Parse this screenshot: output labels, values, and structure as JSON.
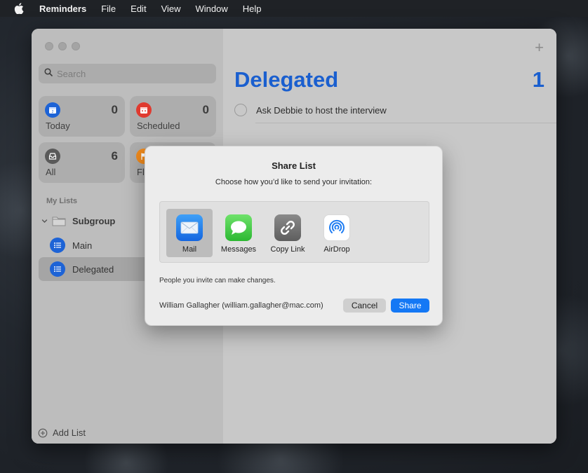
{
  "menubar": {
    "app": "Reminders",
    "items": [
      "File",
      "Edit",
      "View",
      "Window",
      "Help"
    ]
  },
  "sidebar": {
    "search_placeholder": "Search",
    "smart_lists": [
      {
        "label": "Today",
        "count": "0",
        "color": "#1d63d6",
        "icon": "calendar-icon"
      },
      {
        "label": "Scheduled",
        "count": "0",
        "color": "#e03a2f",
        "icon": "scheduled-calendar-icon"
      },
      {
        "label": "All",
        "count": "6",
        "color": "#5a5a5a",
        "icon": "tray-icon"
      },
      {
        "label": "Fl",
        "count": "",
        "color": "#f08a1c",
        "icon": "flag-icon"
      }
    ],
    "my_lists_heading": "My Lists",
    "group": {
      "label": "Subgroup"
    },
    "lists": [
      {
        "label": "Main"
      },
      {
        "label": "Delegated"
      }
    ],
    "add_list": "Add List"
  },
  "main": {
    "title": "Delegated",
    "count": "1",
    "tasks": [
      {
        "text": "Ask Debbie to host the interview"
      }
    ]
  },
  "dialog": {
    "title": "Share List",
    "subtitle": "Choose how you’d like to send your invitation:",
    "options": [
      {
        "label": "Mail",
        "icon": "mail-icon"
      },
      {
        "label": "Messages",
        "icon": "messages-icon"
      },
      {
        "label": "Copy Link",
        "icon": "link-icon"
      },
      {
        "label": "AirDrop",
        "icon": "airdrop-icon"
      }
    ],
    "note": "People you invite can make changes.",
    "account": "William Gallagher (william.gallagher@mac.com)",
    "cancel_label": "Cancel",
    "share_label": "Share"
  }
}
